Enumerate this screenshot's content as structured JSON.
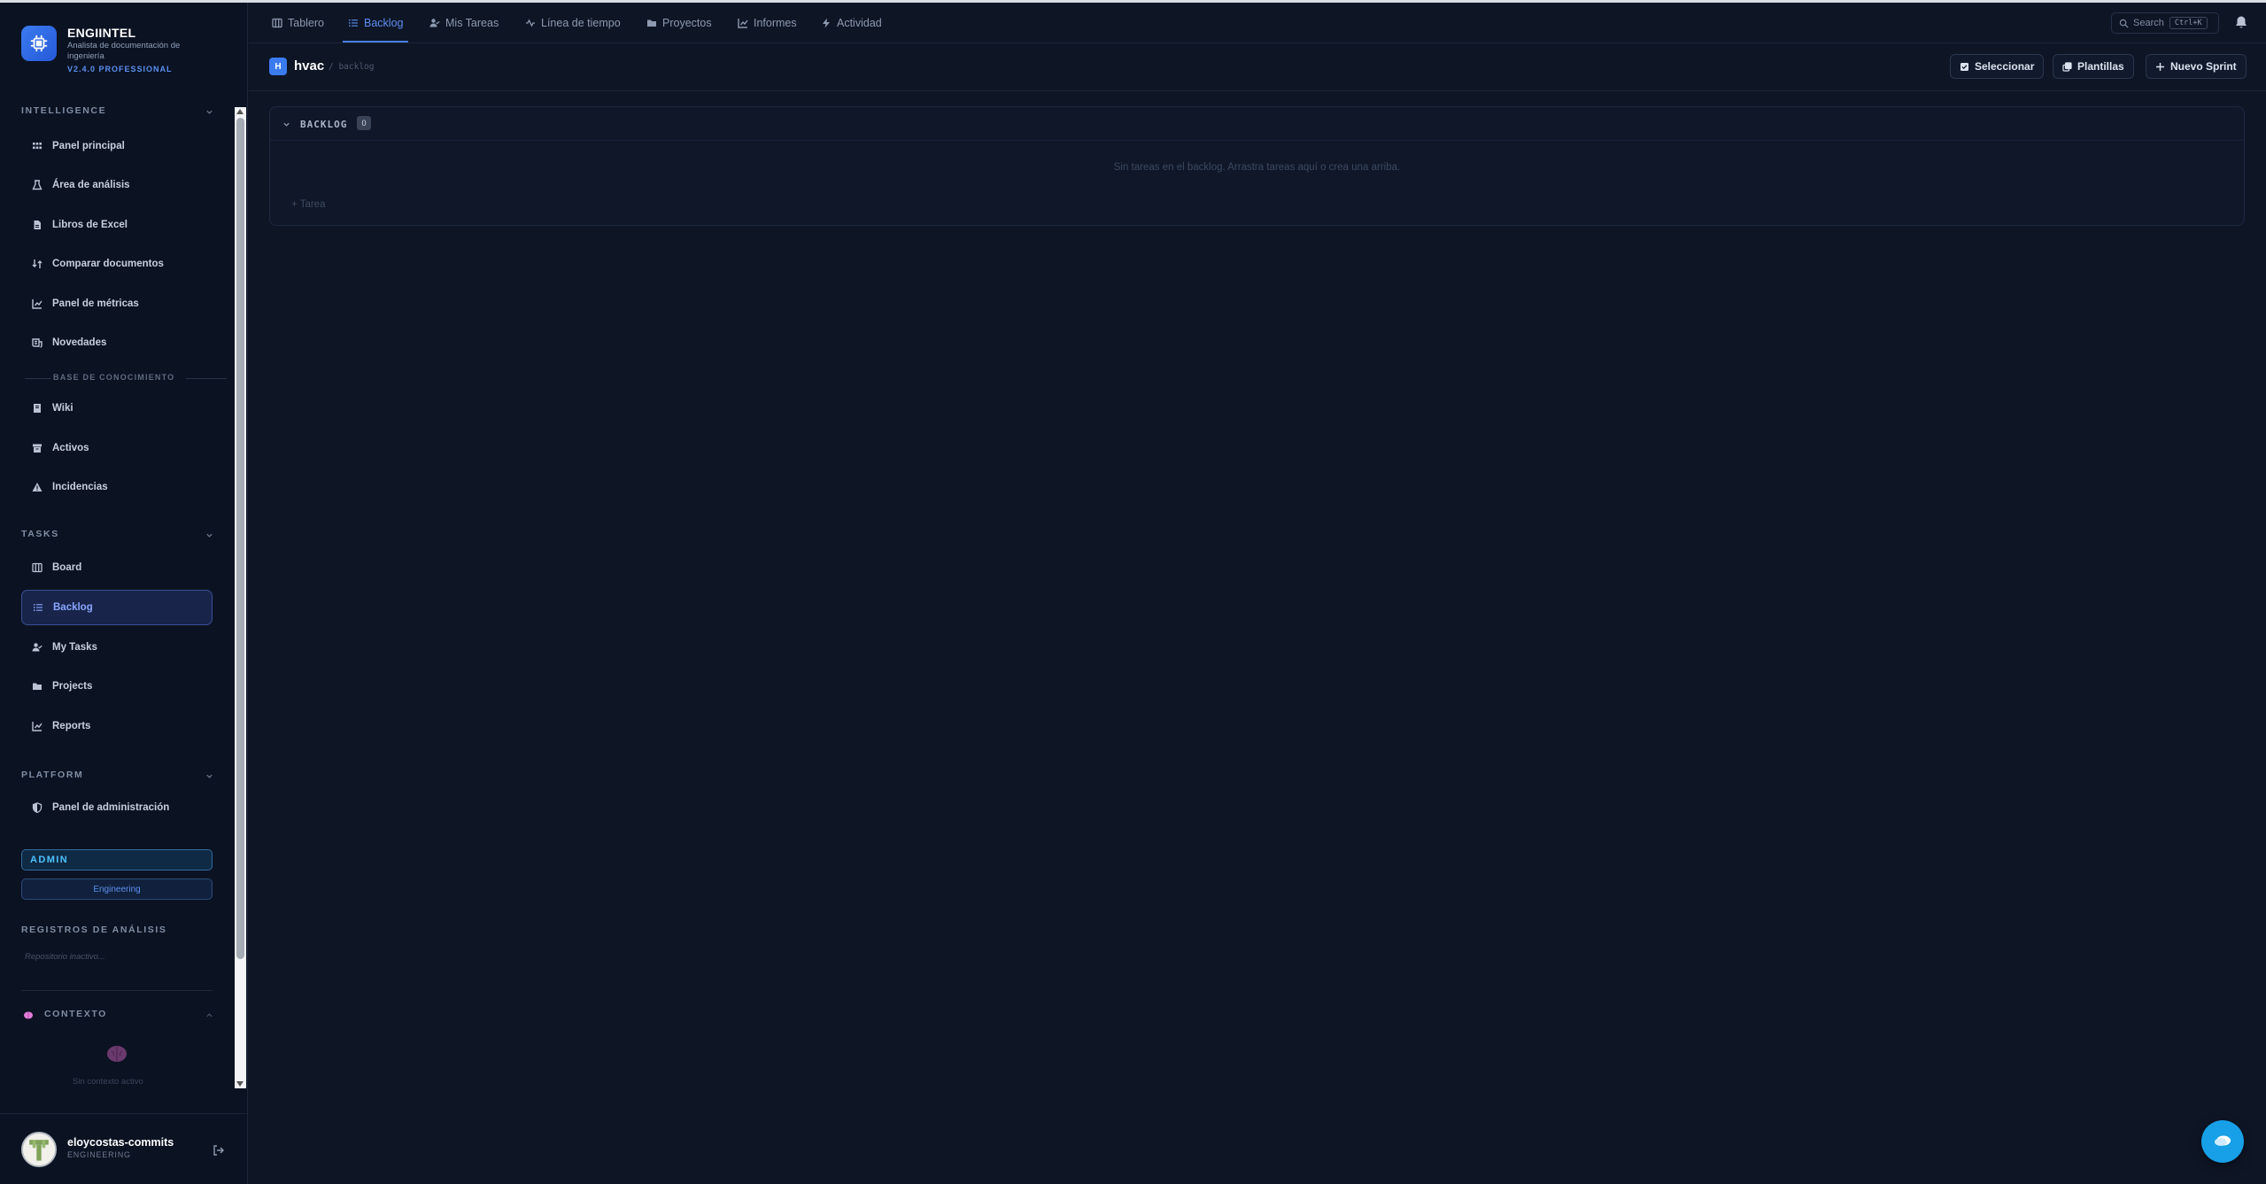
{
  "brand": {
    "name": "ENGIINTEL",
    "subtitle": "Analista de documentación de ingeniería",
    "version": "V2.4.0 PROFESSIONAL"
  },
  "sidebar": {
    "intelligence": {
      "title": "INTELLIGENCE",
      "items": [
        {
          "label": "Panel principal",
          "icon": "grid-icon"
        },
        {
          "label": "Área de análisis",
          "icon": "flask-icon"
        },
        {
          "label": "Libros de Excel",
          "icon": "file-icon"
        },
        {
          "label": "Comparar documentos",
          "icon": "compare-icon"
        },
        {
          "label": "Panel de métricas",
          "icon": "chart-icon"
        },
        {
          "label": "Novedades",
          "icon": "news-icon"
        }
      ],
      "kb_title": "BASE DE CONOCIMIENTO",
      "kb_items": [
        {
          "label": "Wiki",
          "icon": "book-icon"
        },
        {
          "label": "Activos",
          "icon": "archive-icon"
        },
        {
          "label": "Incidencias",
          "icon": "warning-icon"
        }
      ]
    },
    "tasks": {
      "title": "TASKS",
      "items": [
        {
          "label": "Board",
          "icon": "columns-icon"
        },
        {
          "label": "Backlog",
          "icon": "list-icon",
          "active": true
        },
        {
          "label": "My Tasks",
          "icon": "user-check-icon"
        },
        {
          "label": "Projects",
          "icon": "folder-icon"
        },
        {
          "label": "Reports",
          "icon": "chart-icon"
        }
      ]
    },
    "platform": {
      "title": "PLATFORM",
      "items": [
        {
          "label": "Panel de administración",
          "icon": "shield-icon"
        }
      ]
    },
    "role": "ADMIN",
    "department": "Engineering",
    "logs": {
      "title": "REGISTROS DE ANÁLISIS",
      "empty": "Repositorio inactivo..."
    },
    "context": {
      "title": "CONTEXTO",
      "empty": "Sin contexto activo"
    }
  },
  "user": {
    "name": "eloycostas-commits",
    "department": "ENGINEERING"
  },
  "topnav": {
    "tabs": [
      {
        "label": "Tablero",
        "icon": "columns-icon"
      },
      {
        "label": "Backlog",
        "icon": "list-icon",
        "active": true
      },
      {
        "label": "Mis Tareas",
        "icon": "user-check-icon"
      },
      {
        "label": "Línea de tiempo",
        "icon": "timeline-icon"
      },
      {
        "label": "Proyectos",
        "icon": "folder-icon"
      },
      {
        "label": "Informes",
        "icon": "chart-icon"
      },
      {
        "label": "Actividad",
        "icon": "bolt-icon"
      }
    ],
    "search": {
      "label": "Search",
      "shortcut": "Ctrl+K"
    }
  },
  "page": {
    "project_initial": "H",
    "project_name": "hvac",
    "breadcrumb": "/ backlog",
    "buttons": {
      "select": "Seleccionar",
      "templates": "Plantillas",
      "new_sprint": "Nuevo Sprint"
    }
  },
  "backlog": {
    "title": "BACKLOG",
    "count": "0",
    "empty_message": "Sin tareas en el backlog. Arrastra tareas aquí o crea una arriba.",
    "add_task": "+ Tarea"
  },
  "colors": {
    "accent": "#4a7ff0",
    "background": "#0e1525",
    "sidebar": "#0b1222",
    "fab": "#17a0e8"
  }
}
